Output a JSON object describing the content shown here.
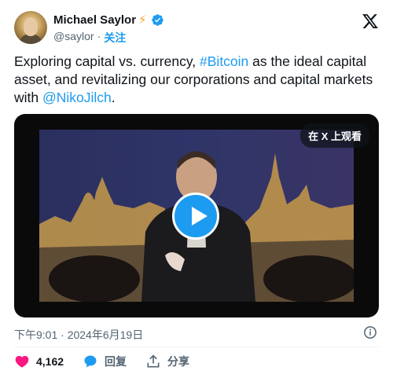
{
  "author": {
    "name": "Michael Saylor",
    "name_emoji": "⚡",
    "handle": "@saylor",
    "separator": "·",
    "follow_label": "关注"
  },
  "tweet": {
    "text_1": "Exploring capital vs. currency, ",
    "hashtag": "#Bitcoin",
    "text_2": " as the ideal capital asset, and revitalizing our corporations and capital markets with ",
    "mention": "@NikoJilch",
    "text_3": "."
  },
  "media": {
    "watch_on_x_label": "在 X 上观看"
  },
  "meta": {
    "timestamp": "下午9:01 · 2024年6月19日"
  },
  "actions": {
    "like_count": "4,162",
    "reply_label": "回复",
    "share_label": "分享"
  },
  "colors": {
    "accent": "#1d9bf0",
    "text": "#0f1419",
    "muted": "#536471",
    "like": "#f91880"
  },
  "icons": [
    "verified-badge-icon",
    "x-logo-icon",
    "play-icon",
    "info-icon",
    "heart-icon",
    "reply-bubble-icon",
    "share-icon"
  ]
}
